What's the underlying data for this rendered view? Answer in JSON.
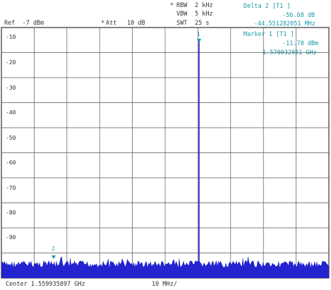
{
  "header": {
    "rbw_label": "RBW",
    "rbw_value": "2 kHz",
    "vbw_label": "VBW",
    "vbw_value": "5 kHz",
    "swt_label": "SWT",
    "swt_value": "25 s",
    "ref_level": "Ref  -7 dBm",
    "att_label": "Att",
    "att_value": "10 dB",
    "star": "*"
  },
  "delta_marker": {
    "label": "Delta 2 [T1 ]",
    "level": "-56.68 dB",
    "frequency": "-44.551282051 MHz"
  },
  "marker1": {
    "label": "Marker 1 [T1 ]",
    "level": "-11.78 dBm",
    "frequency": "1.570032051 GHz"
  },
  "trace_markers": {
    "m1": "1",
    "m2": "2"
  },
  "y_axis": {
    "labels": [
      "-10",
      "-20",
      "-30",
      "-40",
      "-50",
      "-60",
      "-70",
      "-80",
      "-90"
    ]
  },
  "footer": {
    "center": "Center 1.559935897 GHz",
    "span_per_div": "10 MHz/"
  },
  "colors": {
    "trace": "#2323d0",
    "marker": "#1a9aa6",
    "grid": "#555555"
  }
}
